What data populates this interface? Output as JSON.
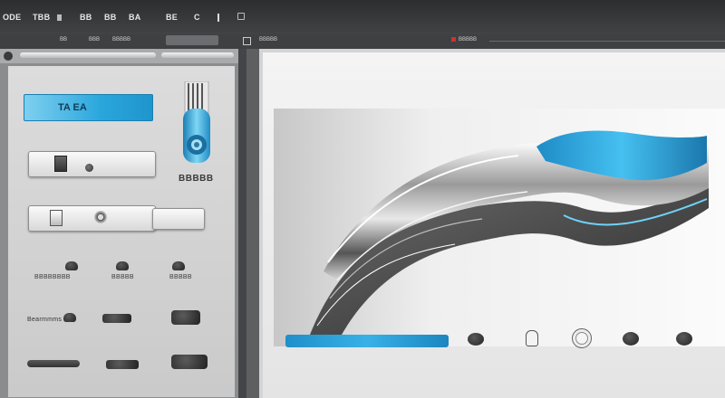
{
  "window": {
    "title": "",
    "accent_color": "#2aa6dc"
  },
  "menubar": {
    "items": [
      {
        "label": "ODE",
        "icon": "app-logo-icon"
      },
      {
        "label": "TBB",
        "icon": ""
      },
      {
        "label": "1G",
        "icon": "menu-icon"
      },
      {
        "label": "BB",
        "icon": "menu-icon"
      },
      {
        "label": "BB",
        "icon": "menu-icon"
      },
      {
        "label": "BA",
        "icon": "menu-icon"
      },
      {
        "label": "BE",
        "icon": "menu-icon"
      },
      {
        "label": "C",
        "icon": "menu-icon"
      }
    ]
  },
  "toolbar": {
    "tab_labels": [
      "BB",
      "BBB",
      "BBBBB",
      "BBBBB"
    ],
    "right_label": "BBBBB"
  },
  "left_panel": {
    "title_field": "TA   EA",
    "tube_label": "BBBBB",
    "row_labels": [
      "BBBBBBBB",
      "BBBBB",
      "BBBBB"
    ],
    "small_label": "Bearmmms"
  }
}
